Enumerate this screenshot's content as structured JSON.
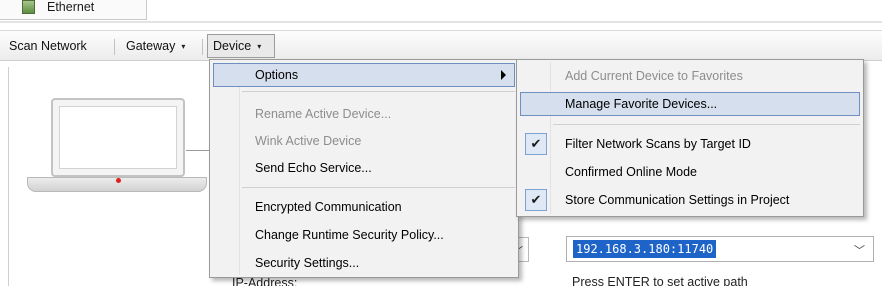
{
  "tabs": {
    "ethernet_label": "Ethernet",
    "ethernet_icon": "network-adapter-icon"
  },
  "toolbar": {
    "scan_network_label": "Scan Network",
    "gateway_label": "Gateway",
    "device_label": "Device",
    "dropdown_glyph": "▾"
  },
  "device_menu": {
    "options": "Options",
    "rename_active_device": "Rename Active Device...",
    "wink_active_device": "Wink Active Device",
    "send_echo_service": "Send Echo Service...",
    "encrypted_communication": "Encrypted Communication",
    "change_runtime_security_policy": "Change Runtime Security Policy...",
    "security_settings": "Security Settings..."
  },
  "options_menu": {
    "add_current_device_to_favorites": "Add Current Device to Favorites",
    "manage_favorite_devices": "Manage Favorite Devices...",
    "filter_network_scans_by_target_id": "Filter Network Scans by Target ID",
    "confirmed_online_mode": "Confirmed Online Mode",
    "store_communication_settings_in_project": "Store Communication Settings in Project",
    "check_glyph": "✔"
  },
  "content": {
    "active_path_value": "192.168.3.180:11740",
    "press_enter_hint": "Press ENTER to set active path",
    "ip_address_label": "IP-Address:",
    "combo_arrow": "﹀"
  },
  "colors": {
    "menu_highlight": "#d6dfed",
    "menu_highlight_border": "#6f8fc0",
    "selection_blue": "#1e64c8",
    "disabled_text": "#8d8d8d"
  }
}
